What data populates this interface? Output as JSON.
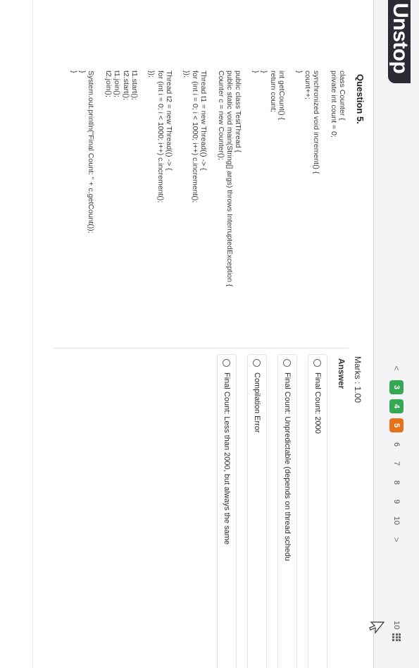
{
  "app": {
    "logo": "Unstop"
  },
  "pager": {
    "prev_label": "<",
    "items": [
      {
        "label": "3",
        "state": "answered"
      },
      {
        "label": "4",
        "state": "answered"
      },
      {
        "label": "5",
        "state": "current"
      },
      {
        "label": "6",
        "state": "default"
      },
      {
        "label": "7",
        "state": "default"
      },
      {
        "label": "8",
        "state": "default"
      },
      {
        "label": "9",
        "state": "default"
      },
      {
        "label": "10",
        "state": "default"
      }
    ],
    "next_label": ">",
    "total_label": "10",
    "grid_icon": "grid-icon"
  },
  "question": {
    "title": "Question 5.",
    "marks": "Marks : 1.00",
    "code_lines": [
      "class Counter {",
      "private int count = 0;",
      "",
      "synchronized void increment() {",
      "count++;",
      "}",
      "",
      "int getCount() {",
      "return count;",
      "}",
      "}",
      "",
      "public class TestThread {",
      "public static void main(String[] args) throws InterruptedException {",
      "Counter c = new Counter();",
      "",
      "Thread t1 = new Thread(() -> {",
      "for (int i = 0; i < 1000; i++) c.increment();",
      "});",
      "",
      "Thread t2 = new Thread(() -> {",
      "for (int i = 0; i < 1000; i++) c.increment();",
      "});",
      "",
      "t1.start();",
      "t2.start();",
      "t1.join();",
      "t2.join();",
      "",
      "System.out.println(\"Final Count: \" + c.getCount());",
      "}",
      "}"
    ]
  },
  "answer": {
    "label": "Answer",
    "options": [
      {
        "label": "Final Count: 2000"
      },
      {
        "label": "Final Count: Unpredictable (depends on thread schedu"
      },
      {
        "label": "Compilation Error"
      },
      {
        "label": "Final Count: Less than 2000, but always the same"
      }
    ]
  },
  "colors": {
    "answered": "#34a853",
    "current": "#e8711c",
    "logo_bg": "#2b2b33"
  }
}
